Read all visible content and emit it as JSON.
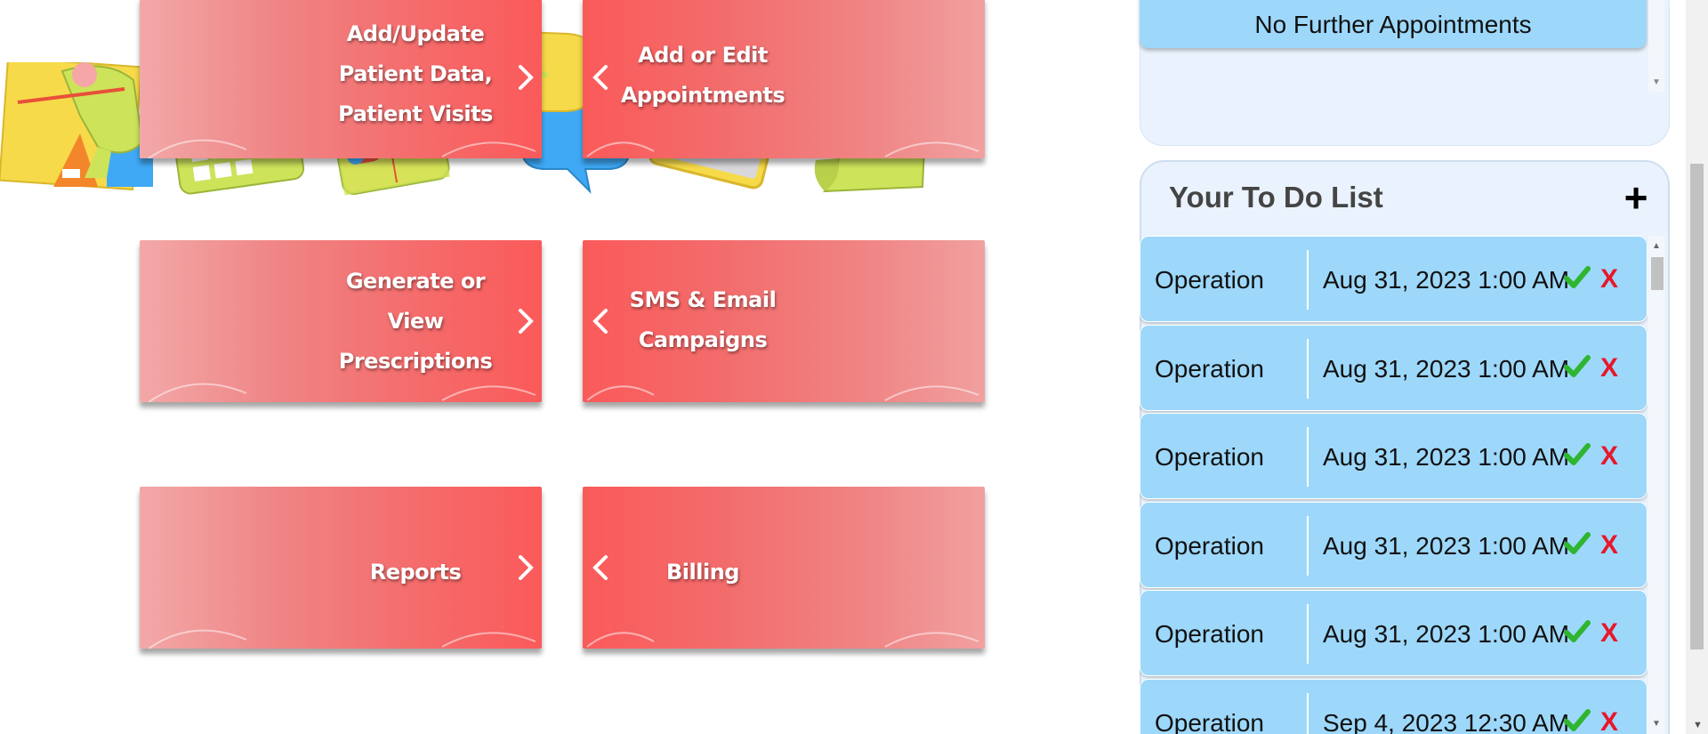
{
  "tiles": [
    {
      "id": "patient-data",
      "label": "Add/Update\nPatient Data,\nPatient Visits",
      "art": "patient-icon"
    },
    {
      "id": "appointments",
      "label": "Add or Edit\nAppointments",
      "art": "calendar-icon"
    },
    {
      "id": "prescriptions",
      "label": "Generate or\nView\nPrescriptions",
      "art": "pills-icon"
    },
    {
      "id": "campaigns",
      "label": "SMS & Email\nCampaigns",
      "art": "chat-bubbles-icon"
    },
    {
      "id": "reports",
      "label": "Reports",
      "art": "clipboard-icon"
    },
    {
      "id": "billing",
      "label": "Billing",
      "art": "bill-icon"
    }
  ],
  "appointments": {
    "empty_text": "No Further Appointments"
  },
  "todo": {
    "title": "Your To Do List",
    "add_symbol": "+",
    "done_symbol": "✔",
    "remove_symbol": "X",
    "items": [
      {
        "name": "Operation",
        "date": "Aug 31, 2023 1:00 AM"
      },
      {
        "name": "Operation",
        "date": "Aug 31, 2023 1:00 AM"
      },
      {
        "name": "Operation",
        "date": "Aug 31, 2023 1:00 AM"
      },
      {
        "name": "Operation",
        "date": "Aug 31, 2023 1:00 AM"
      },
      {
        "name": "Operation",
        "date": "Aug 31, 2023 1:00 AM"
      },
      {
        "name": "Operation",
        "date": "Sep 4, 2023 12:30 AM"
      }
    ]
  },
  "colors": {
    "tile_red": "#fb5a5a",
    "list_blue": "#9dd8fb",
    "panel_bg": "#eaf3fd",
    "check_green": "#2fb52f",
    "remove_red": "#e8172b"
  }
}
